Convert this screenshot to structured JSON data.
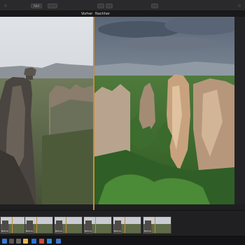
{
  "toolbar": {
    "left_button": "fold",
    "center_button_a": "",
    "center_button_b": "",
    "right_button": ""
  },
  "compare": {
    "before_label": "Vorher",
    "after_label": "Nachher"
  },
  "filmstrip": {
    "thumbnails": [
      {
        "caption": "Before"
      },
      {
        "caption": "Before"
      },
      {
        "caption": "Before"
      },
      {
        "caption": "Before"
      },
      {
        "caption": "Before"
      },
      {
        "caption": "Before"
      }
    ]
  },
  "taskbar": {
    "icons": [
      "windows-start-icon",
      "search-icon",
      "task-view-icon",
      "file-explorer-icon",
      "store-icon",
      "mail-icon",
      "photo-app-icon",
      "browser-icon",
      "app-icon"
    ]
  },
  "colors": {
    "divider": "#c98b3a",
    "background": "#1f1f21"
  }
}
